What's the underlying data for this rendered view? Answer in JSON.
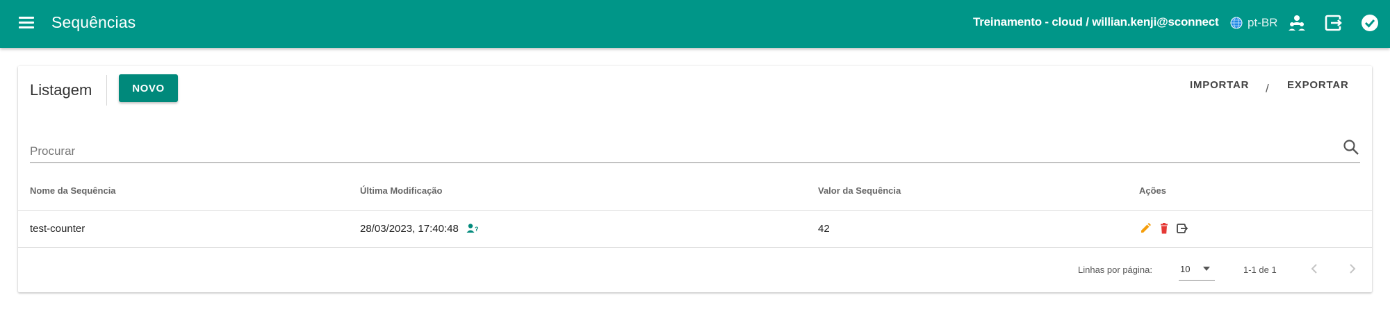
{
  "appbar": {
    "title": "Sequências",
    "context": "Treinamento - cloud / willian.kenji@sconnect",
    "language": "pt-BR",
    "color": "#009688",
    "icons": [
      "menu-icon",
      "globe-icon",
      "users-icon",
      "exit-icon",
      "check-circle-icon"
    ]
  },
  "listing": {
    "title": "Listagem",
    "new_button": "NOVO",
    "import_button": "IMPORTAR",
    "separator": "/",
    "export_button": "EXPORTAR",
    "accent": "#00897b"
  },
  "search": {
    "placeholder": "Procurar",
    "value": ""
  },
  "table": {
    "columns": [
      "Nome da Sequência",
      "Última Modificação",
      "Valor da Sequência",
      "Ações"
    ],
    "rows": [
      {
        "name": "test-counter",
        "modified": "28/03/2023, 17:40:48",
        "value": "42",
        "actions": [
          "edit-icon",
          "delete-icon",
          "export-icon"
        ]
      }
    ],
    "action_colors": {
      "edit": "#f59e0b",
      "delete": "#e53935",
      "export": "#444444"
    }
  },
  "pagination": {
    "rows_per_page_label": "Linhas por página:",
    "rows_per_page": "10",
    "range": "1-1 de 1"
  }
}
